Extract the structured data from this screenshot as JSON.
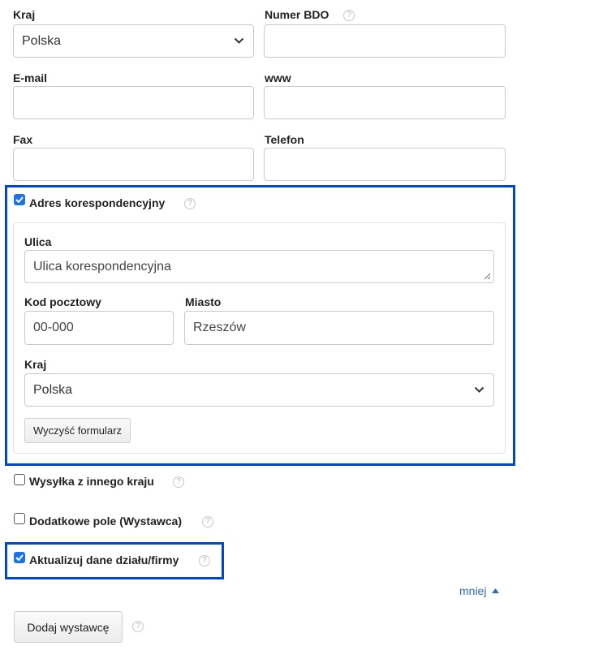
{
  "top": {
    "country_label": "Kraj",
    "country_value": "Polska",
    "bdo_label": "Numer BDO",
    "bdo_value": "",
    "email_label": "E-mail",
    "email_value": "",
    "www_label": "www",
    "www_value": "",
    "fax_label": "Fax",
    "fax_value": "",
    "phone_label": "Telefon",
    "phone_value": ""
  },
  "correspondence": {
    "checkbox_label": "Adres korespondencyjny",
    "checked": true,
    "street_label": "Ulica",
    "street_placeholder": "Ulica korespondencyjna",
    "postal_label": "Kod pocztowy",
    "postal_placeholder": "00-000",
    "city_label": "Miasto",
    "city_placeholder": "Rzeszów",
    "country_label": "Kraj",
    "country_value": "Polska",
    "clear_button": "Wyczyść formularz"
  },
  "options": {
    "shipping_label": "Wysyłka z innego kraju",
    "shipping_checked": false,
    "extra_field_label": "Dodatkowe pole (Wystawca)",
    "extra_field_checked": false,
    "update_label": "Aktualizuj dane działu/firmy",
    "update_checked": true
  },
  "less_link": "mniej",
  "add_button": "Dodaj wystawcę",
  "help_glyph": "?",
  "icons": [
    "chevron-down-icon",
    "help-icon",
    "checkmark-icon",
    "caret-up-icon",
    "resize-grip-icon"
  ],
  "colors": {
    "highlight_frame": "#0047cc",
    "checkbox": "#1a73e8",
    "link": "#2c6db5"
  }
}
